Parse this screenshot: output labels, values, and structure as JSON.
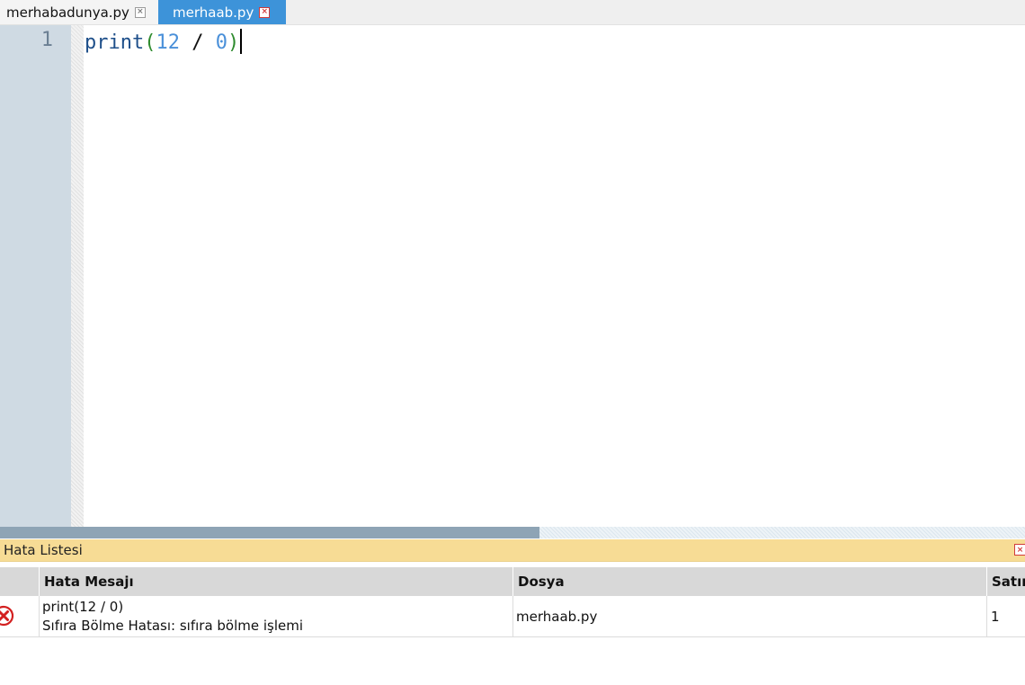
{
  "tabs": [
    {
      "label": "merhabadunya.py",
      "close": "×"
    },
    {
      "label": "merhaab.py",
      "close": "×",
      "active": true
    }
  ],
  "editor": {
    "line_number": "1",
    "code": {
      "keyword": "print",
      "open_paren": "(",
      "num1": "12",
      "operator": " / ",
      "num2": "0",
      "close_paren": ")"
    }
  },
  "error_panel": {
    "title": "Hata Listesi",
    "close": "×",
    "columns": [
      "Hata Mesajı",
      "Dosya",
      "Satır"
    ],
    "rows": [
      {
        "icon": "error-icon",
        "message_line1": "print(12 / 0)",
        "message_line2": "Sıfıra Bölme Hatası: sıfıra bölme işlemi",
        "file": "merhaab.py",
        "line": "1"
      }
    ]
  },
  "colors": {
    "active_tab": "#3d93d9",
    "panel_header": "#f7dc95",
    "error_red": "#d32020",
    "gutter": "#cfdae3"
  }
}
